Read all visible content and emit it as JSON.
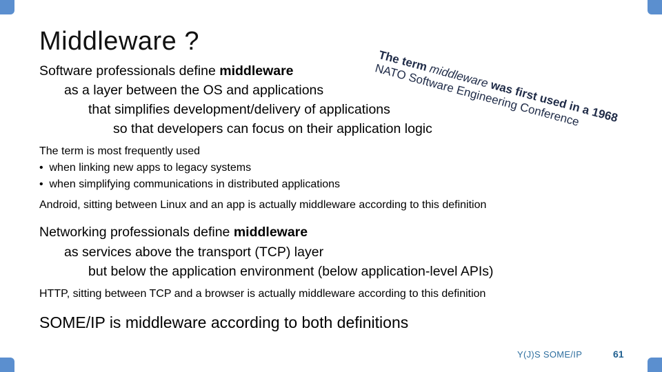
{
  "slide": {
    "title": "Middleware ?",
    "section1": {
      "lead_prefix": "Software professionals define ",
      "lead_bold": "middleware",
      "lines": [
        "as a layer between the OS and applications",
        "that simplifies development/delivery of applications",
        "so that developers can focus on their application logic"
      ]
    },
    "callout": {
      "line1_prefix": "The term ",
      "line1_italic": "middleware",
      "line1_suffix": " was first used in a 1968",
      "line2": "NATO Software Engineering Conference"
    },
    "usage": {
      "intro": "The term is most frequently used",
      "bullets": [
        "when linking new apps to legacy systems",
        "when simplifying communications in distributed applications"
      ],
      "bullet_glyph": "•",
      "note": "Android, sitting between Linux and an app is actually middleware according to this definition"
    },
    "section2": {
      "lead_prefix": "Networking professionals define ",
      "lead_bold": "middleware",
      "lines": [
        "as services above the transport (TCP) layer",
        "but below the application environment (below application-level APIs)"
      ],
      "note": "HTTP, sitting between TCP and a browser is actually middleware according to this definition"
    },
    "conclusion": "SOME/IP is middleware according to both definitions",
    "footer": {
      "label": "Y(J)S  SOME/IP",
      "page_number": "61"
    },
    "colors": {
      "accent": "#5b8fcf",
      "callout_text": "#1f2b47",
      "footer_text": "#2f6f9f"
    }
  }
}
